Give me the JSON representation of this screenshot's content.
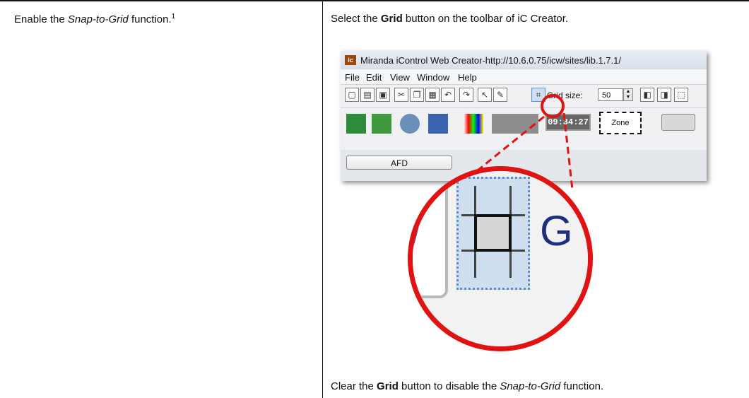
{
  "left_cell": {
    "text_before": "Enable the ",
    "emphasis": "Snap-to-Grid",
    "text_after": " function.",
    "footnote_mark": "1"
  },
  "right_cell": {
    "instruction_before": "Select the ",
    "instruction_bold": "Grid",
    "instruction_after": " button on the toolbar of iC Creator.",
    "clear_before": "Clear the ",
    "clear_bold": "Grid",
    "clear_mid": " button to disable the ",
    "clear_emphasis": "Snap-to-Grid",
    "clear_after": " function."
  },
  "screenshot": {
    "app_icon_text": "ic",
    "window_title": "Miranda iControl Web Creator-http://10.6.0.75/icw/sites/lib.1.7.1/",
    "menu": [
      "File",
      "Edit",
      "View",
      "Window",
      "Help"
    ],
    "grid_size_label": "Grid size:",
    "grid_size_value": "50",
    "clock_text": "09:34:27",
    "zone_label": "Zone",
    "tab_label": "AFD",
    "zoom_letter": "G"
  },
  "colors": {
    "callout": "#e01212",
    "grid_button_bg": "#cfdff0"
  }
}
